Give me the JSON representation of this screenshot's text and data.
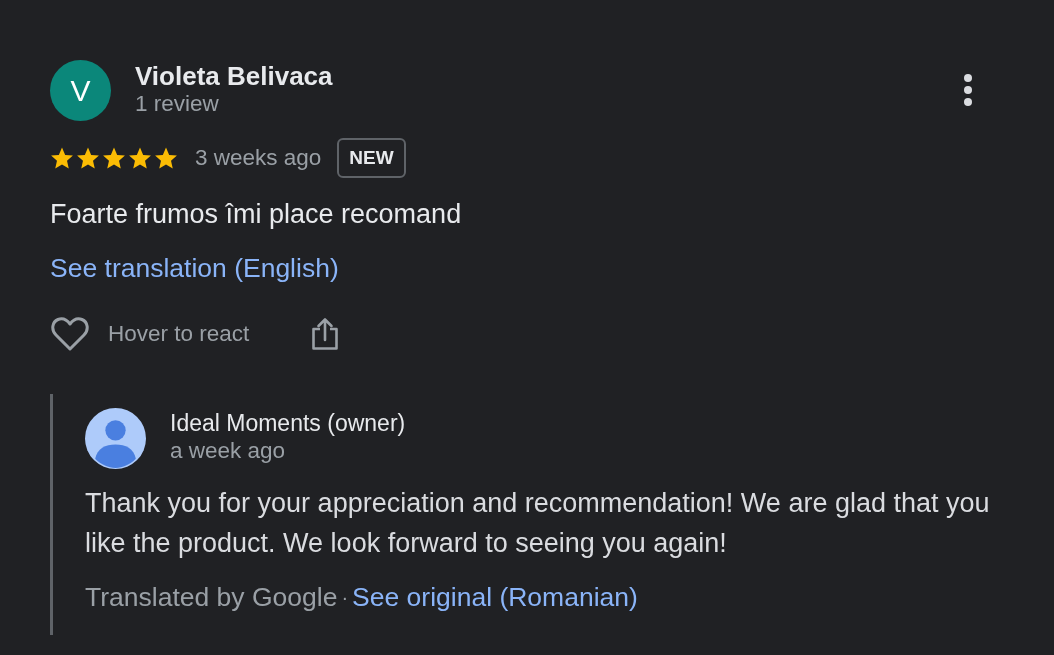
{
  "review": {
    "author": {
      "initial": "V",
      "name": "Violeta Belivaca",
      "review_count": "1 review"
    },
    "stars": 5,
    "time": "3 weeks ago",
    "badge": "NEW",
    "text": "Foarte frumos îmi place recomand",
    "translate_link": "See translation (English)",
    "react_label": "Hover to react"
  },
  "owner_reply": {
    "name": "Ideal Moments (owner)",
    "time": "a week ago",
    "text": "Thank you for your appreciation and recommendation! We are glad that you like the product. We look forward to seeing you again!",
    "translated_by": "Translated by Google",
    "separator": "·",
    "original_link": "See original (Romanian)"
  }
}
